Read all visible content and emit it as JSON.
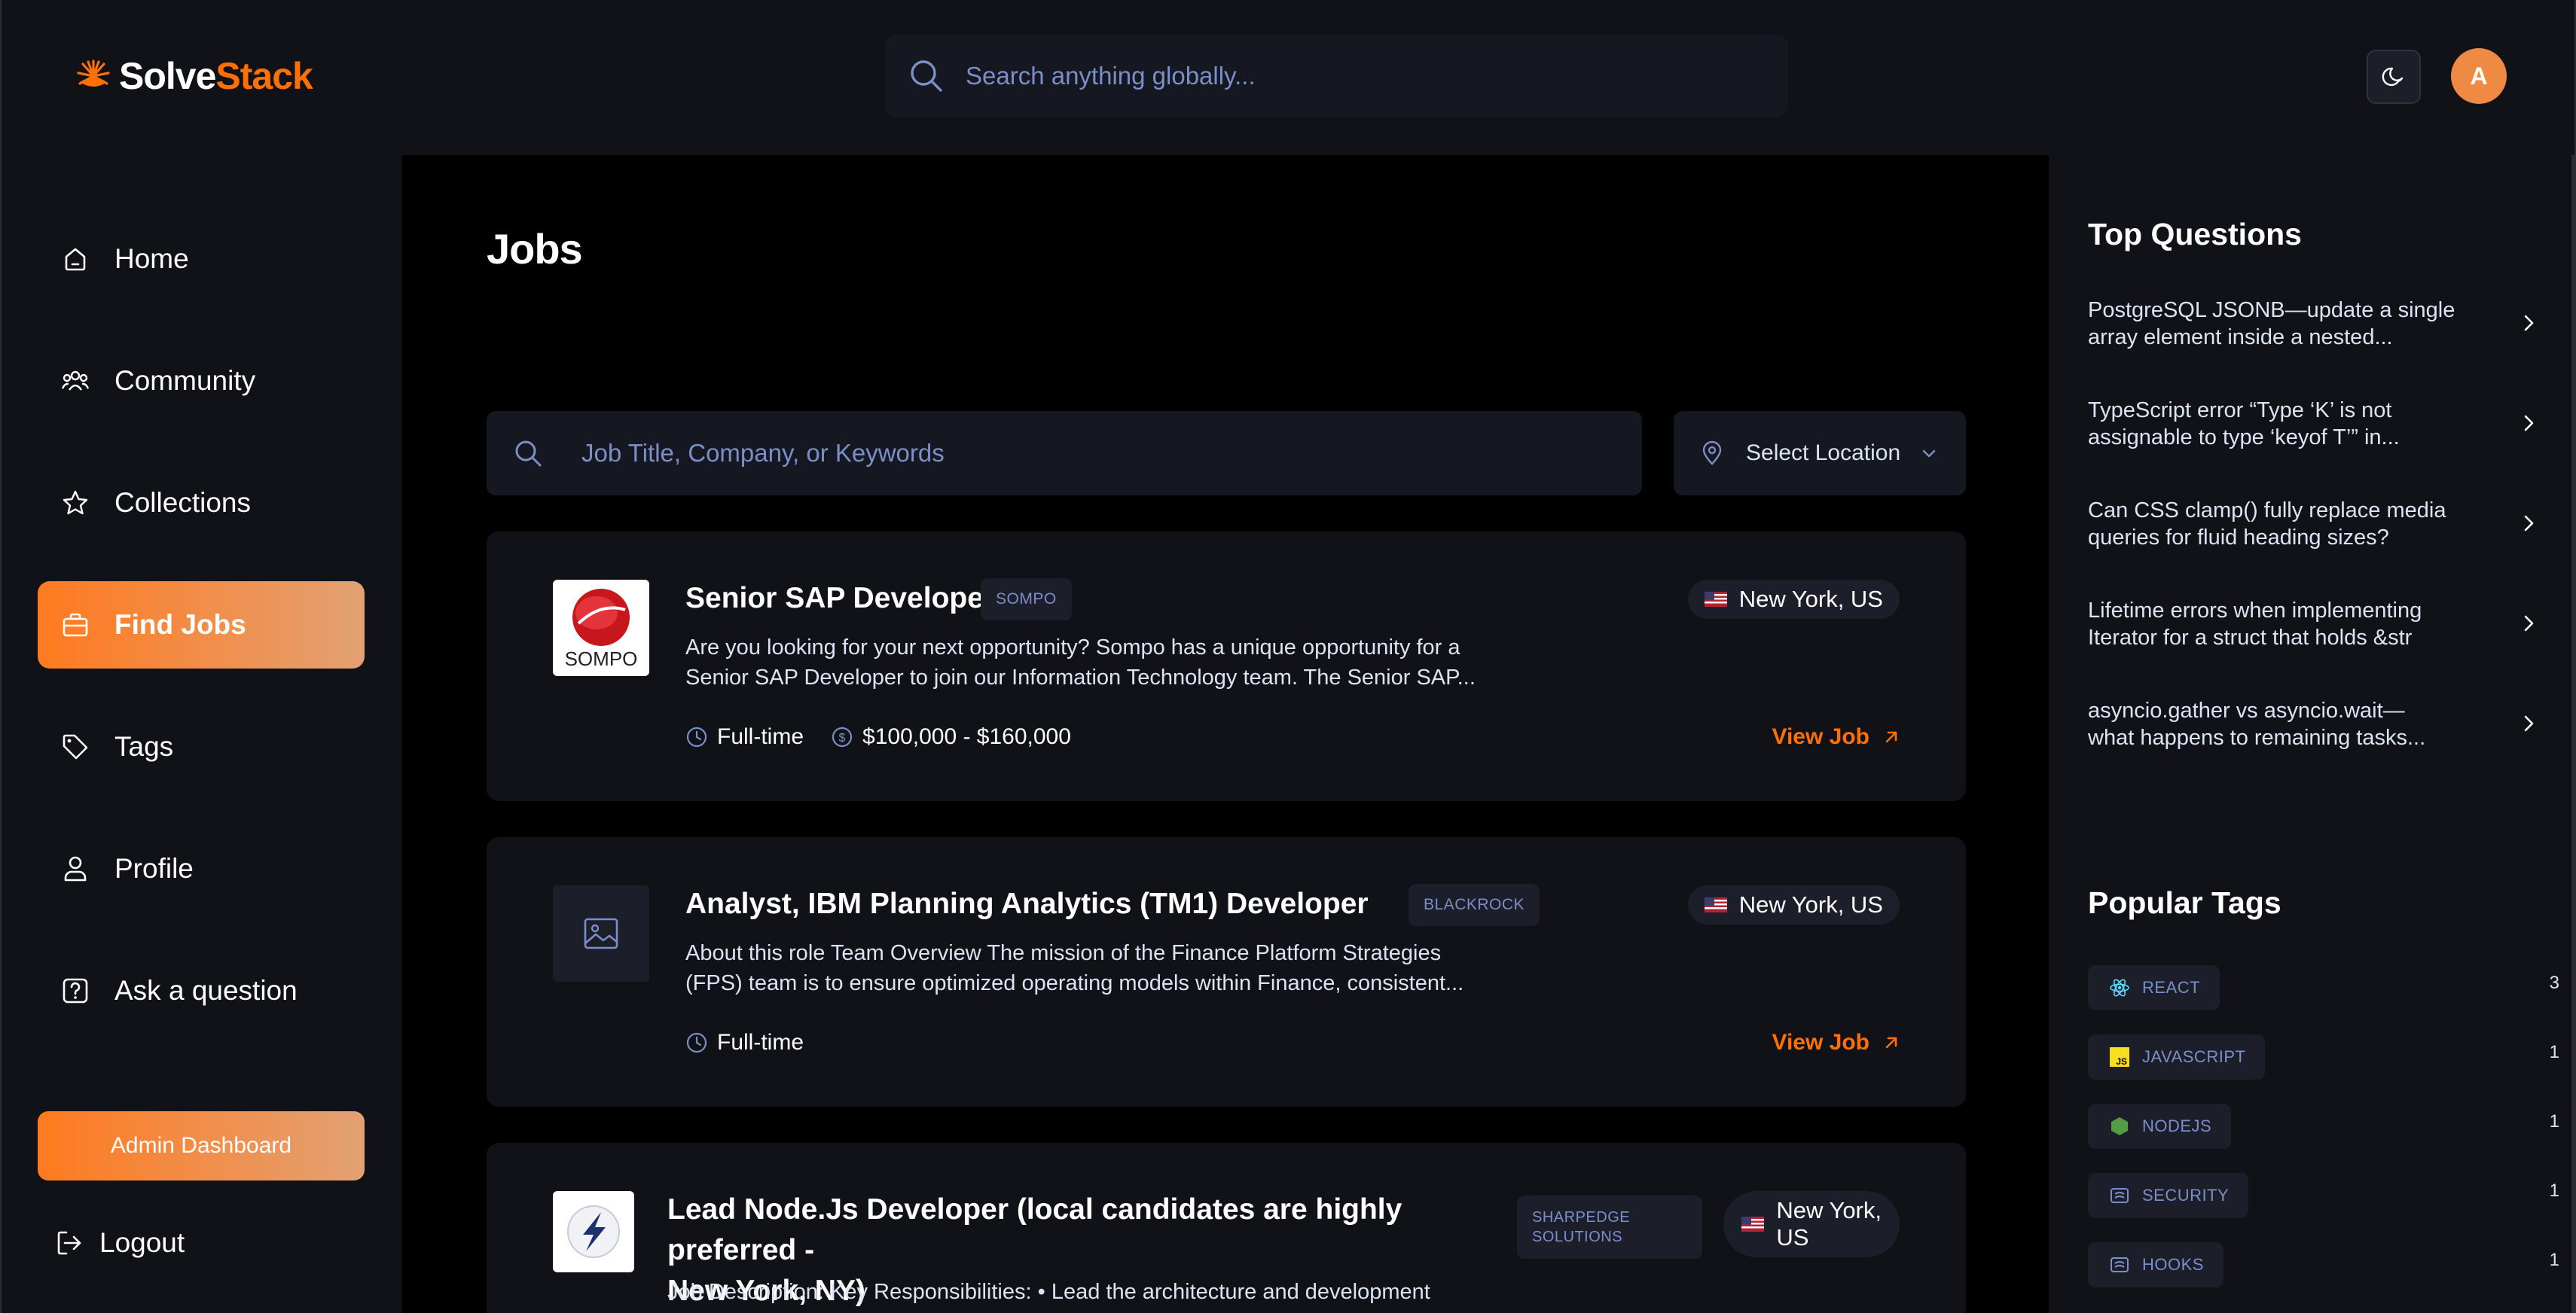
{
  "app": {
    "name_part1": "Solve",
    "name_part2": "Stack"
  },
  "header": {
    "search_placeholder": "Search anything globally...",
    "avatar_initial": "A"
  },
  "sidebar": {
    "items": [
      {
        "label": "Home",
        "icon": "home-icon"
      },
      {
        "label": "Community",
        "icon": "users-icon"
      },
      {
        "label": "Collections",
        "icon": "star-icon"
      },
      {
        "label": "Find Jobs",
        "icon": "briefcase-icon",
        "active": true
      },
      {
        "label": "Tags",
        "icon": "tag-icon"
      },
      {
        "label": "Profile",
        "icon": "user-icon"
      },
      {
        "label": "Ask a question",
        "icon": "question-icon"
      }
    ],
    "admin_label": "Admin Dashboard",
    "logout_label": "Logout"
  },
  "main": {
    "title": "Jobs",
    "search_placeholder": "Job Title, Company, or Keywords",
    "location_label": "Select Location",
    "jobs": [
      {
        "title": "Senior SAP Developer",
        "company": "SOMPO",
        "logo_text": "SOMPO",
        "location": "New York, US",
        "description_line1": "Are you looking for your next opportunity? Sompo has a unique opportunity for a",
        "description_line2": "Senior SAP Developer to join our Information Technology team. The Senior SAP...",
        "employment_type": "Full-time",
        "salary": "$100,000 - $160,000",
        "view_label": "View Job"
      },
      {
        "title": "Analyst, IBM Planning Analytics (TM1) Developer",
        "company": "BLACKROCK",
        "location": "New York, US",
        "description_line1": "About this role Team Overview The mission of the Finance Platform Strategies",
        "description_line2": "(FPS) team is to ensure optimized operating models within Finance, consistent...",
        "employment_type": "Full-time",
        "view_label": "View Job"
      },
      {
        "title_line1": "Lead Node.Js Developer (local candidates are highly preferred -",
        "title_line2": "New York, NY)",
        "company_line1": "SHARPEDGE",
        "company_line2": "SOLUTIONS",
        "location_line1": "New York,",
        "location_line2": "US",
        "description_line1": "Job Description: Key Responsibilities: • Lead the architecture and development"
      }
    ]
  },
  "rightbar": {
    "top_questions_title": "Top Questions",
    "questions": [
      {
        "line1": "PostgreSQL JSONB—update a single",
        "line2": "array element inside a nested..."
      },
      {
        "line1": "TypeScript error “Type ‘K’ is not",
        "line2": "assignable to type ‘keyof T’” in..."
      },
      {
        "line1": "Can CSS clamp() fully replace media",
        "line2": "queries for fluid heading sizes?"
      },
      {
        "line1": "Lifetime errors when implementing",
        "line2": "Iterator for a struct that holds &str"
      },
      {
        "line1": "asyncio.gather vs asyncio.wait—",
        "line2": "what happens to remaining tasks..."
      }
    ],
    "popular_tags_title": "Popular Tags",
    "tags": [
      {
        "name": "REACT",
        "count": "3",
        "icon": "react-icon"
      },
      {
        "name": "JAVASCRIPT",
        "count": "1",
        "icon": "javascript-icon"
      },
      {
        "name": "NODEJS",
        "count": "1",
        "icon": "nodejs-icon"
      },
      {
        "name": "SECURITY",
        "count": "1",
        "icon": "security-icon"
      },
      {
        "name": "HOOKS",
        "count": "1",
        "icon": "hooks-icon"
      }
    ]
  },
  "colors": {
    "accent": "#ff7000",
    "background": "#000000",
    "panel": "#101218",
    "muted_text": "#7b8ec8"
  }
}
